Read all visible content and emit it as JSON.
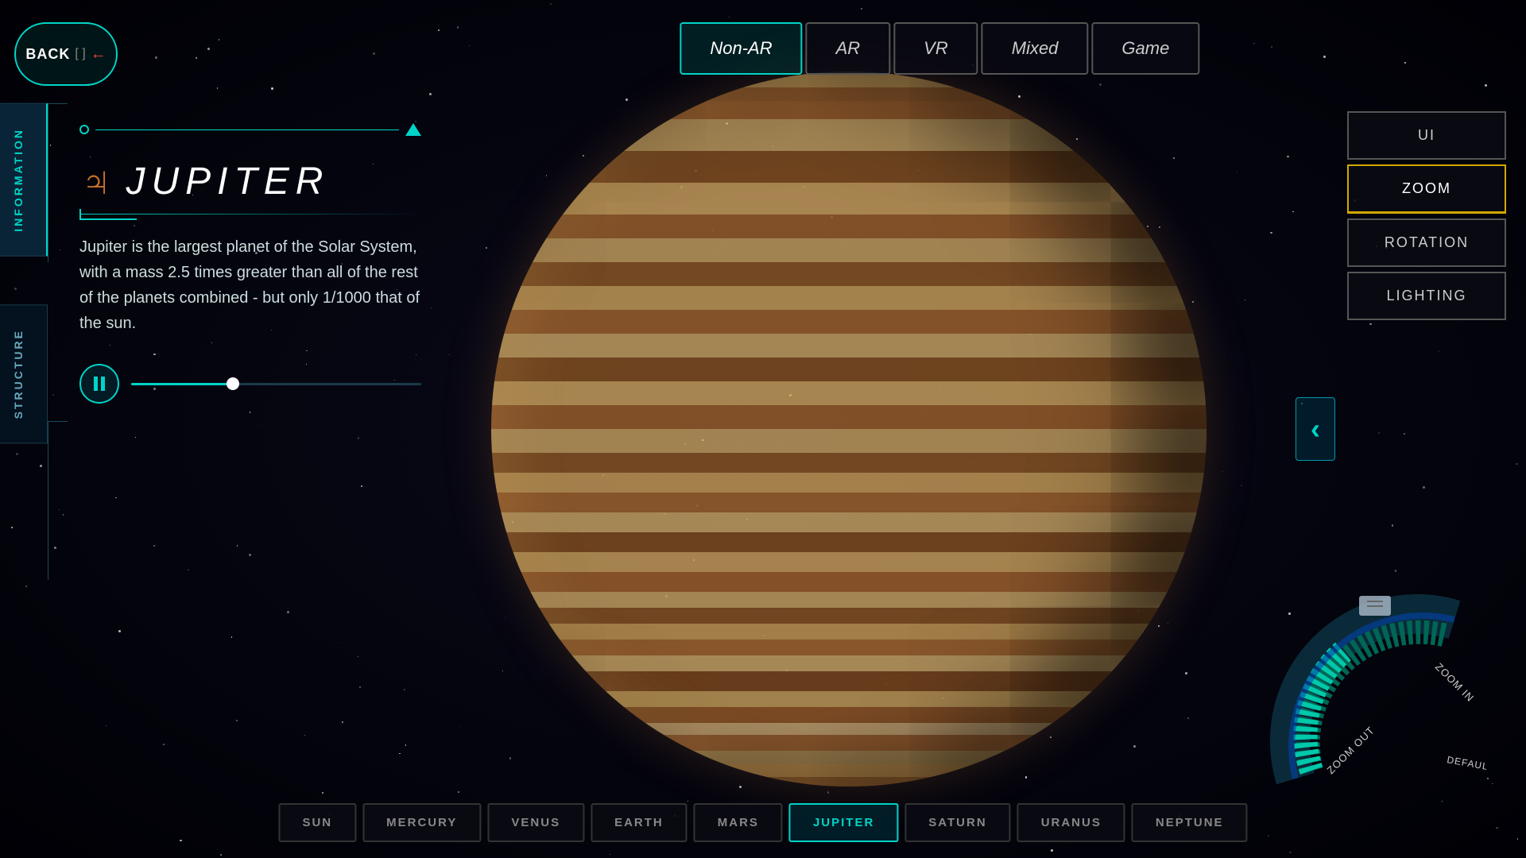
{
  "background": {
    "color": "#000010"
  },
  "header": {
    "back_button": "BACK",
    "back_sep": "[ ]",
    "back_arrow": "←"
  },
  "mode_tabs": [
    {
      "id": "non-ar",
      "label": "Non-AR",
      "active": true
    },
    {
      "id": "ar",
      "label": "AR",
      "active": false
    },
    {
      "id": "vr",
      "label": "VR",
      "active": false
    },
    {
      "id": "mixed",
      "label": "Mixed",
      "active": false
    },
    {
      "id": "game",
      "label": "Game",
      "active": false
    }
  ],
  "right_panel": {
    "buttons": [
      {
        "id": "ui",
        "label": "UI",
        "active": false
      },
      {
        "id": "zoom",
        "label": "ZOOM",
        "active": true
      },
      {
        "id": "rotation",
        "label": "ROTATION",
        "active": false
      },
      {
        "id": "lighting",
        "label": "LIGHTING",
        "active": false
      }
    ]
  },
  "sidebar": {
    "tabs": [
      {
        "id": "information",
        "label": "INFORMATION",
        "active": true
      },
      {
        "id": "structure",
        "label": "STRUCTURE",
        "active": false
      }
    ]
  },
  "planet": {
    "symbol": "♃",
    "name": "JUPITER",
    "description": "Jupiter is the largest planet of the Solar System, with a mass 2.5 times greater than all of the rest of the planets combined - but only 1/1000 that of the sun."
  },
  "audio_player": {
    "state": "playing",
    "progress_percent": 35
  },
  "planet_nav": [
    {
      "id": "sun",
      "label": "SUN",
      "active": false
    },
    {
      "id": "mercury",
      "label": "MERCURY",
      "active": false
    },
    {
      "id": "venus",
      "label": "VENUS",
      "active": false
    },
    {
      "id": "earth",
      "label": "EARTH",
      "active": false
    },
    {
      "id": "mars",
      "label": "MARS",
      "active": false
    },
    {
      "id": "jupiter",
      "label": "JUPITER",
      "active": true
    },
    {
      "id": "saturn",
      "label": "SATURN",
      "active": false
    },
    {
      "id": "uranus",
      "label": "URANUS",
      "active": false
    },
    {
      "id": "neptune",
      "label": "NEPTUNE",
      "active": false
    }
  ],
  "zoom_dial": {
    "zoom_in_label": "ZOOM IN",
    "zoom_out_label": "ZOOM OUT",
    "default_label": "DEFAULT"
  }
}
